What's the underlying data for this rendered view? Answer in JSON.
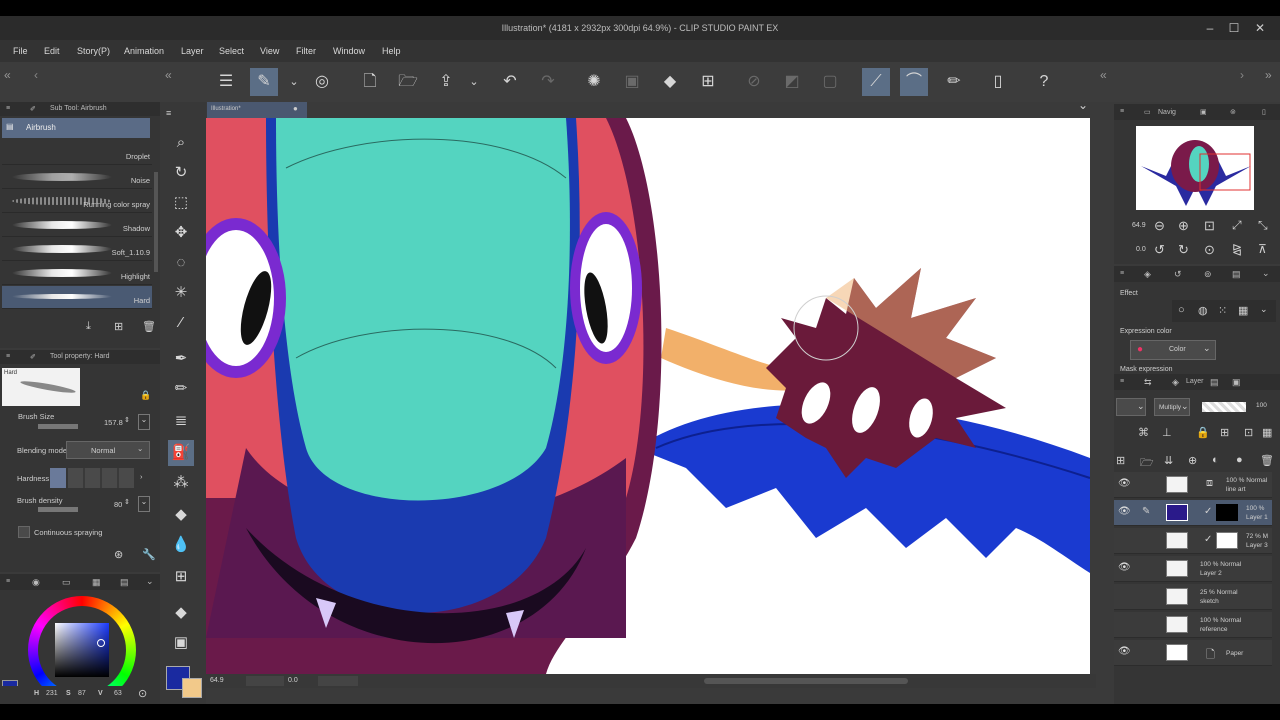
{
  "window": {
    "title": "Illustration* (4181 x 2932px 300dpi 64.9%) - CLIP STUDIO PAINT EX"
  },
  "menu": [
    "File",
    "Edit",
    "Story(P)",
    "Animation",
    "Layer",
    "Select",
    "View",
    "Filter",
    "Window",
    "Help"
  ],
  "canvas": {
    "tab_label": "Illustration*",
    "zoom": "64.9",
    "angle": "0.0"
  },
  "subtool": {
    "header": "Sub Tool: Airbrush",
    "group": "Airbrush",
    "brushes": [
      "Droplet",
      "Noise",
      "Running color spray",
      "Shadow",
      "Soft_1.10.9",
      "Highlight",
      "Hard"
    ],
    "selected": "Hard"
  },
  "tool_property": {
    "header": "Tool property: Hard",
    "preview_label": "Hard",
    "brush_size_label": "Brush Size",
    "brush_size_value": "157.8",
    "blending_label": "Blending mode",
    "blending_value": "Normal",
    "hardness_label": "Hardness",
    "density_label": "Brush density",
    "density_value": "80",
    "continuous_label": "Continuous spraying"
  },
  "color": {
    "h": "231",
    "s": "87",
    "v": "63",
    "h_label": "H",
    "s_label": "S",
    "v_label": "V",
    "main": "#1a2aa0",
    "sub": "#f2c98a"
  },
  "navigator": {
    "header": "Navig",
    "zoom": "64.9",
    "angle": "0.0"
  },
  "effect": {
    "label": "Effect",
    "expression_label": "Expression color",
    "expression_value": "Color",
    "mask_label": "Mask expression"
  },
  "layer_panel": {
    "header": "Layer",
    "blend": "Multiply",
    "opacity": "100",
    "layers": [
      {
        "opacity": "100 %",
        "mode": "Normal",
        "name": "line art"
      },
      {
        "opacity": "100 %",
        "mode": "",
        "name": "Layer 1"
      },
      {
        "opacity": "72 %",
        "mode": "M",
        "name": "Layer 3"
      },
      {
        "opacity": "100 %",
        "mode": "Normal",
        "name": "Layer 2"
      },
      {
        "opacity": "25 %",
        "mode": "Normal",
        "name": "sketch"
      },
      {
        "opacity": "100 %",
        "mode": "Normal",
        "name": "reference"
      },
      {
        "opacity": "",
        "mode": "",
        "name": "Paper"
      }
    ]
  }
}
